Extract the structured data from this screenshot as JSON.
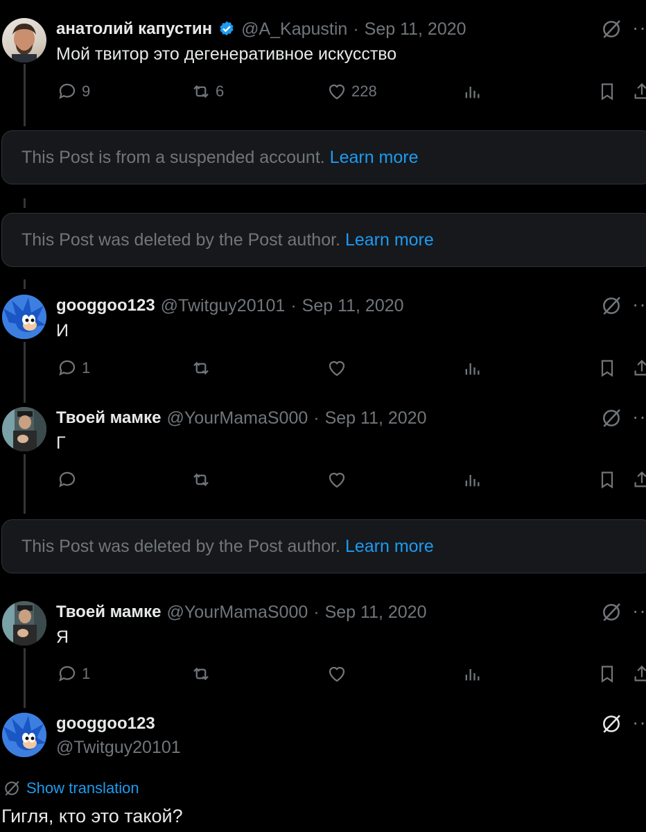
{
  "posts": [
    {
      "name": "анатолий капустин",
      "handle": "@A_Kapustin",
      "date": "Sep 11, 2020",
      "text": "Мой твитор это дегенеративное искусство",
      "replies": "9",
      "reposts": "6",
      "likes": "228"
    },
    {
      "name": "googgoo123",
      "handle": "@Twitguy20101",
      "date": "Sep 11, 2020",
      "text": "И",
      "replies": "1",
      "reposts": "",
      "likes": ""
    },
    {
      "name": "Твоей мамке",
      "handle": "@YourMamaS000",
      "date": "Sep 11, 2020",
      "text": "Г",
      "replies": "",
      "reposts": "",
      "likes": ""
    },
    {
      "name": "Твоей мамке",
      "handle": "@YourMamaS000",
      "date": "Sep 11, 2020",
      "text": "Я",
      "replies": "1",
      "reposts": "",
      "likes": ""
    }
  ],
  "notices": [
    {
      "text": "This Post is from a suspended account. ",
      "link": "Learn more"
    },
    {
      "text": "This Post was deleted by the Post author. ",
      "link": "Learn more"
    },
    {
      "text": "This Post was deleted by the Post author. ",
      "link": "Learn more"
    }
  ],
  "main_post": {
    "name": "googgoo123",
    "handle": "@Twitguy20101",
    "translate_label": "Show translation",
    "text": "Гигля, кто это такой?"
  },
  "separator": "·",
  "more_glyph": "··",
  "colors": {
    "background": "#000000",
    "link": "#1d9bf0",
    "muted": "#71767b",
    "notice_bg": "#16181c"
  }
}
